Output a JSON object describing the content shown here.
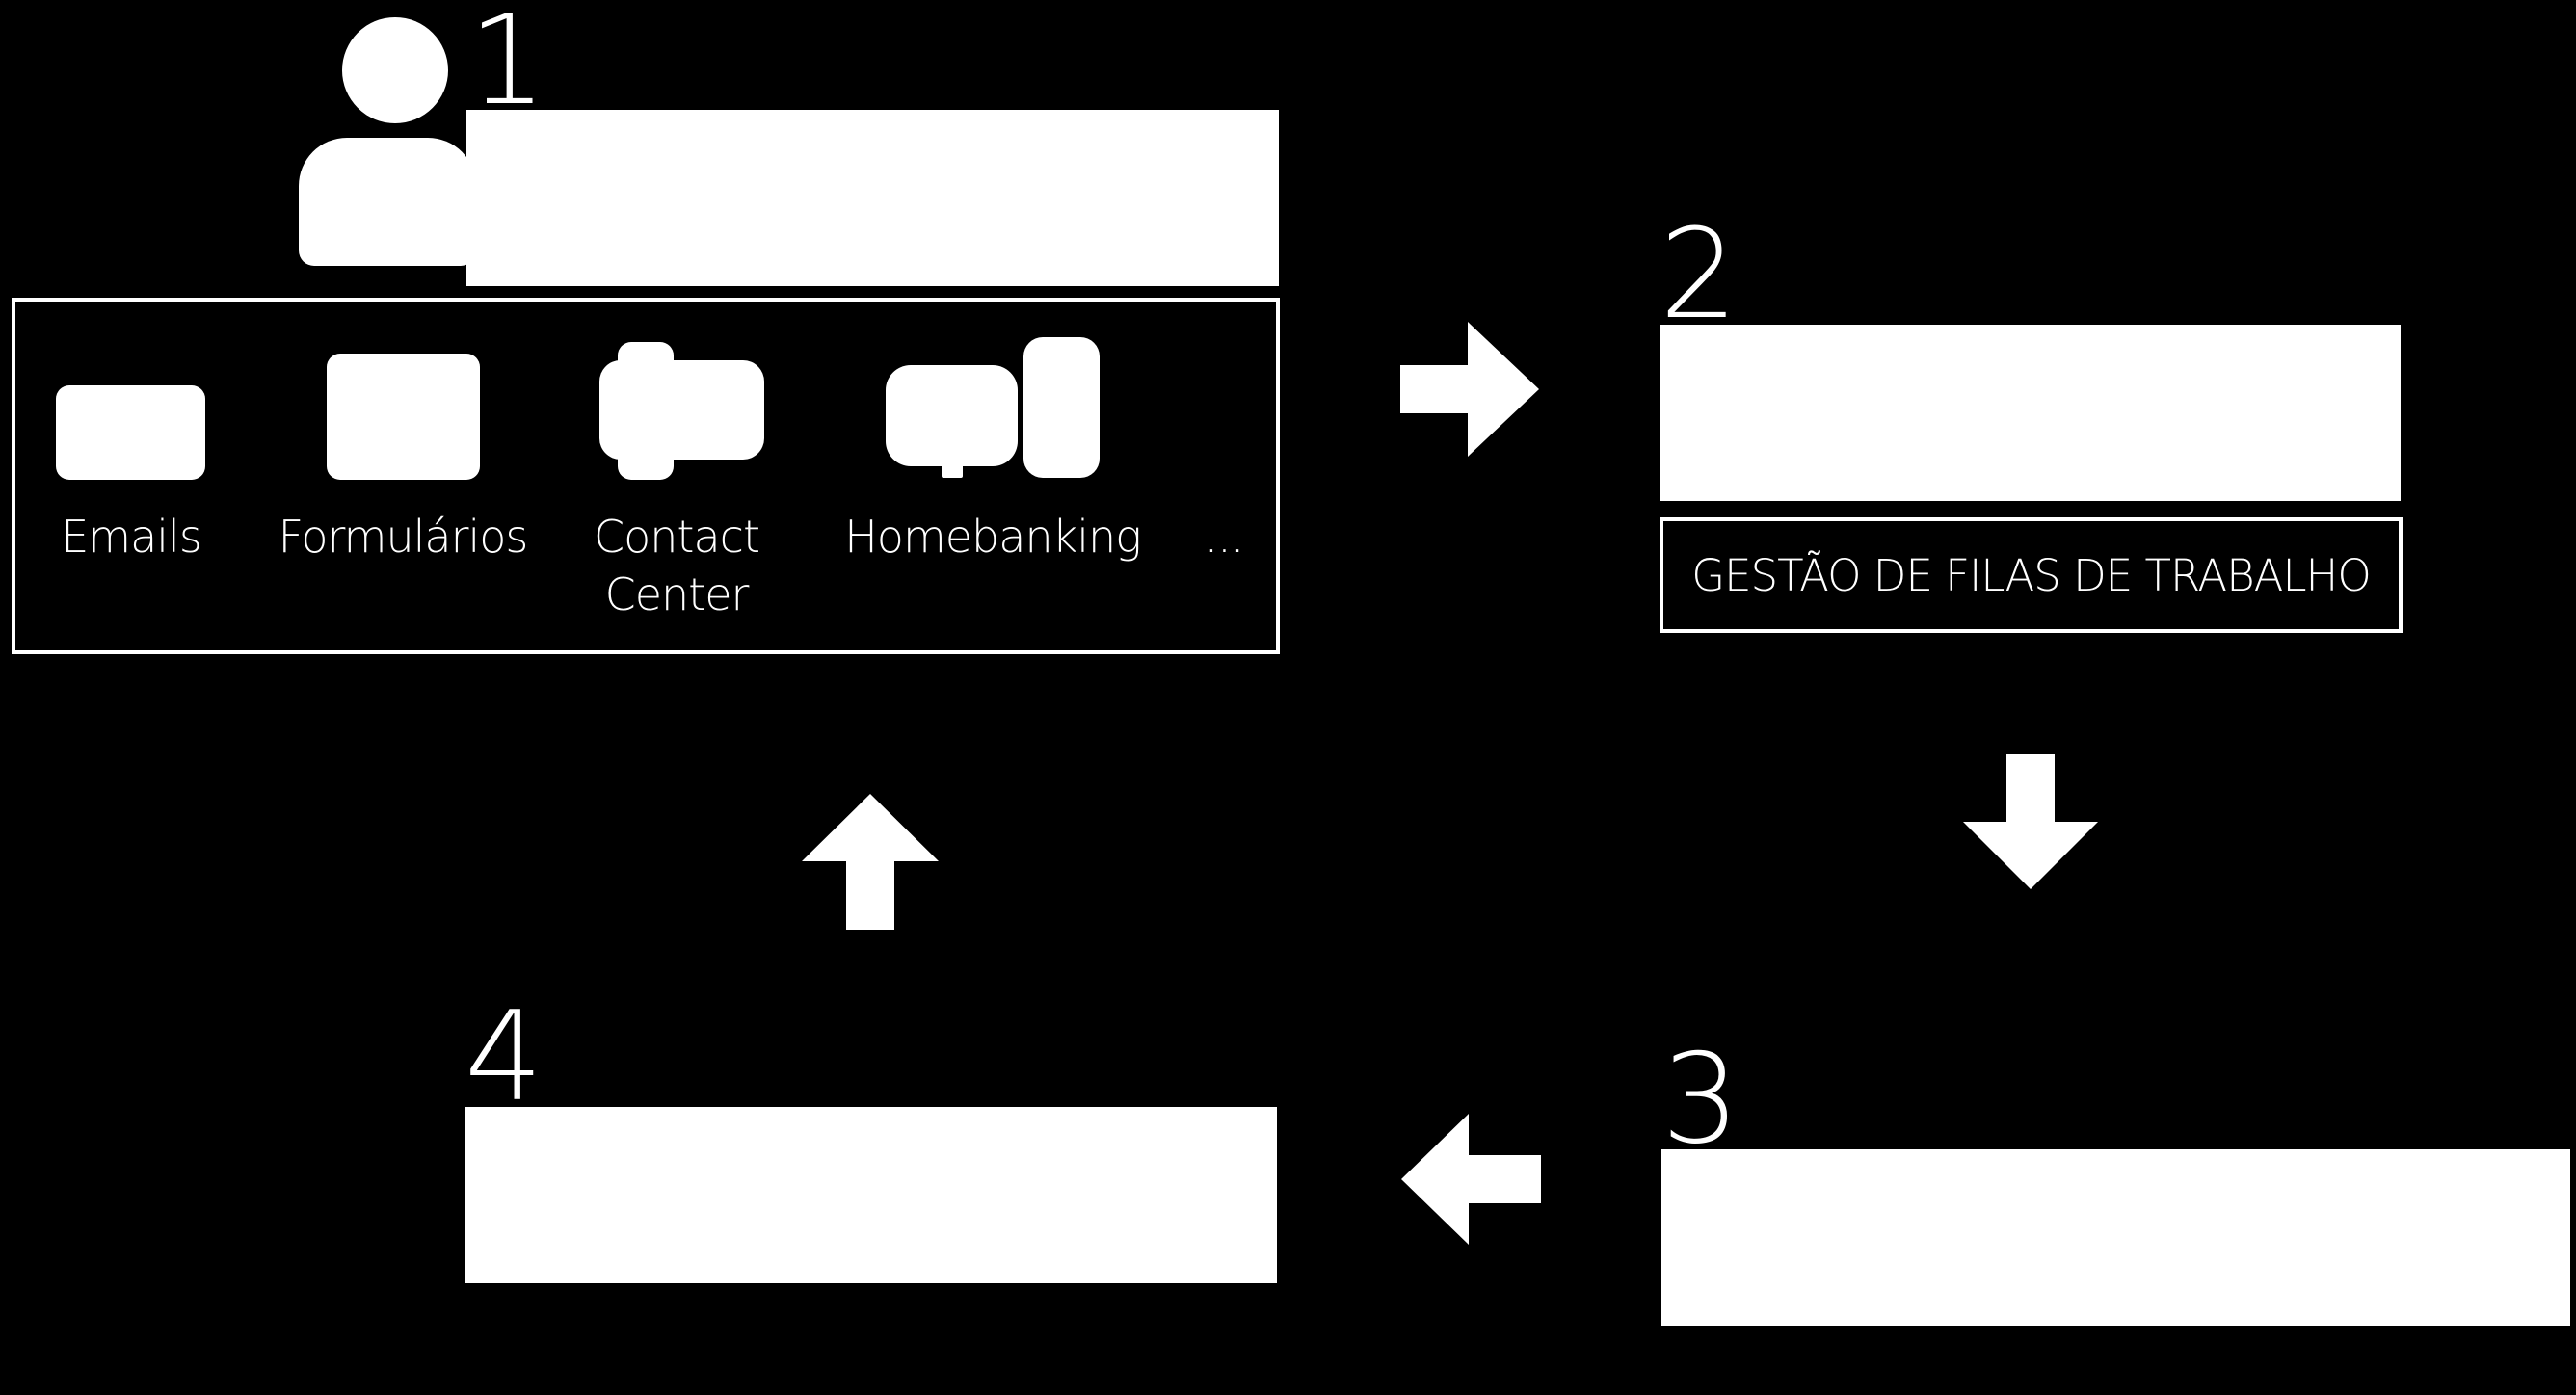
{
  "steps": [
    {
      "number": "1"
    },
    {
      "number": "2",
      "sublabel": "GESTÃO DE FILAS DE TRABALHO"
    },
    {
      "number": "3"
    },
    {
      "number": "4"
    }
  ],
  "channels": [
    {
      "icon": "email-icon",
      "label": "Emails"
    },
    {
      "icon": "form-icon",
      "label": "Formulários"
    },
    {
      "icon": "contact-center-icon",
      "label_line1": "Contact",
      "label_line2": "Center"
    },
    {
      "icon": "homebanking-icon",
      "label": "Homebanking"
    },
    {
      "label": "..."
    }
  ],
  "colors": {
    "background": "#000000",
    "foreground": "#ffffff"
  }
}
